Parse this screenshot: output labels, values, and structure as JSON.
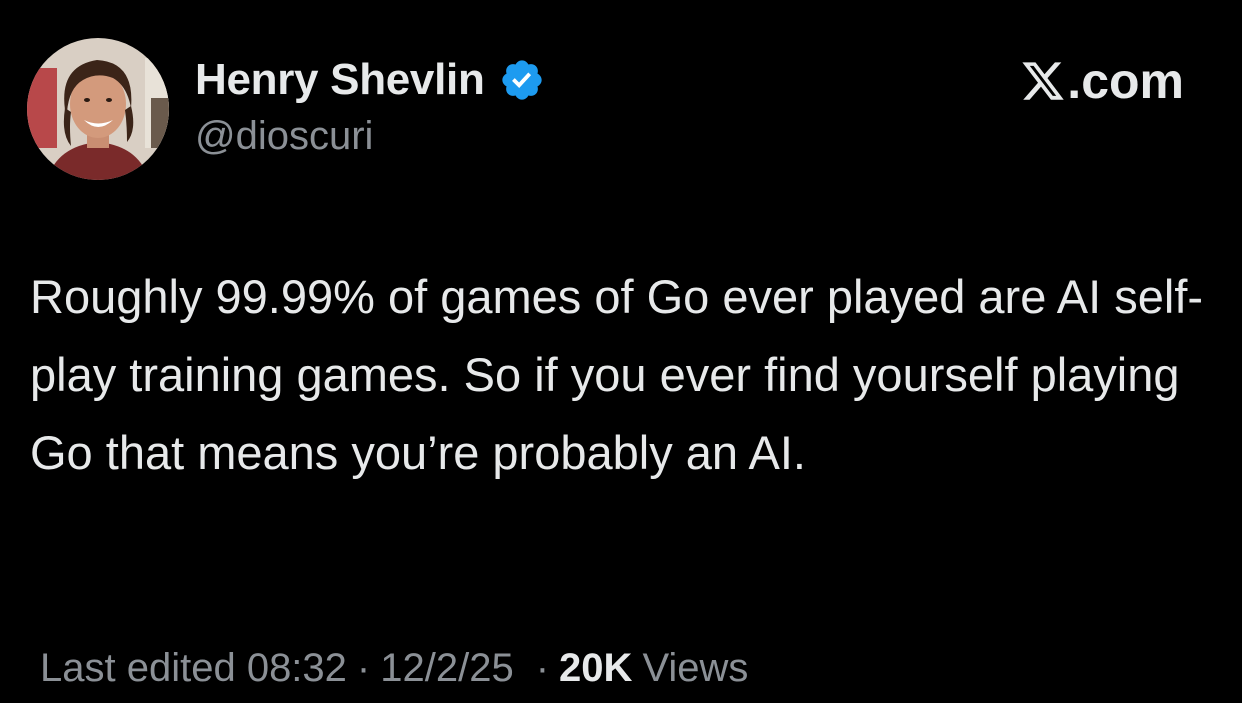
{
  "author": {
    "display_name": "Henry Shevlin",
    "handle": "@dioscuri",
    "verified": true,
    "verified_color": "#1d9bf0",
    "avatar_icon": "profile-photo"
  },
  "brand": {
    "label": ".com",
    "logo_icon": "x-logo-icon"
  },
  "tweet": {
    "text": "Roughly 99.99% of games of Go ever played are AI self-play training games. So if you ever find yourself playing Go that means you’re probably an AI."
  },
  "meta": {
    "edited_label": "Last edited 08:32",
    "separator": "·",
    "date": "12/2/25",
    "views_count": "20K",
    "views_label": "Views"
  },
  "colors": {
    "background": "#000000",
    "primary_text": "#e7e9ea",
    "secondary_text": "#8b9096"
  }
}
